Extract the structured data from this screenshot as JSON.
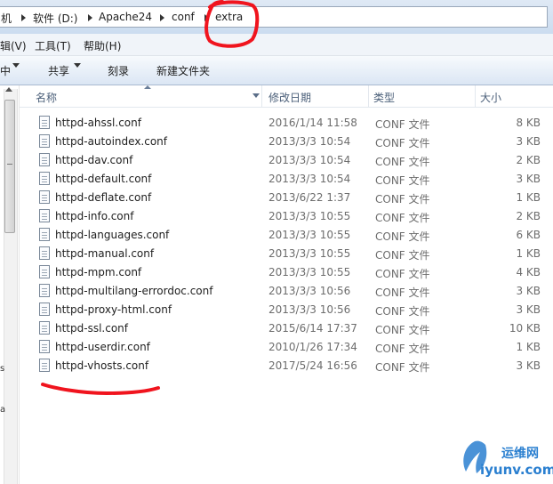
{
  "address": {
    "crumbs": [
      "机",
      "软件 (D:)",
      "Apache24",
      "conf",
      "extra"
    ]
  },
  "menu": {
    "items": [
      "辑(V)",
      "工具(T)",
      "帮助(H)"
    ]
  },
  "toolbar": {
    "left_partial": "中",
    "share_label": "共享",
    "burn_label": "刻录",
    "new_folder_label": "新建文件夹"
  },
  "columns": {
    "name": "名称",
    "date": "修改日期",
    "type": "类型",
    "size": "大小"
  },
  "left_stray": {
    "a": "s",
    "b": "a"
  },
  "files": [
    {
      "name": "httpd-ahssl.conf",
      "date": "2016/1/14 11:58",
      "type": "CONF 文件",
      "size": "8 KB"
    },
    {
      "name": "httpd-autoindex.conf",
      "date": "2013/3/3 10:54",
      "type": "CONF 文件",
      "size": "3 KB"
    },
    {
      "name": "httpd-dav.conf",
      "date": "2013/3/3 10:54",
      "type": "CONF 文件",
      "size": "2 KB"
    },
    {
      "name": "httpd-default.conf",
      "date": "2013/3/3 10:54",
      "type": "CONF 文件",
      "size": "3 KB"
    },
    {
      "name": "httpd-deflate.conf",
      "date": "2013/6/22 1:37",
      "type": "CONF 文件",
      "size": "1 KB"
    },
    {
      "name": "httpd-info.conf",
      "date": "2013/3/3 10:55",
      "type": "CONF 文件",
      "size": "2 KB"
    },
    {
      "name": "httpd-languages.conf",
      "date": "2013/3/3 10:55",
      "type": "CONF 文件",
      "size": "6 KB"
    },
    {
      "name": "httpd-manual.conf",
      "date": "2013/3/3 10:55",
      "type": "CONF 文件",
      "size": "1 KB"
    },
    {
      "name": "httpd-mpm.conf",
      "date": "2013/3/3 10:55",
      "type": "CONF 文件",
      "size": "4 KB"
    },
    {
      "name": "httpd-multilang-errordoc.conf",
      "date": "2013/3/3 10:56",
      "type": "CONF 文件",
      "size": "3 KB"
    },
    {
      "name": "httpd-proxy-html.conf",
      "date": "2013/3/3 10:56",
      "type": "CONF 文件",
      "size": "3 KB"
    },
    {
      "name": "httpd-ssl.conf",
      "date": "2015/6/14 17:37",
      "type": "CONF 文件",
      "size": "10 KB"
    },
    {
      "name": "httpd-userdir.conf",
      "date": "2010/1/26 17:34",
      "type": "CONF 文件",
      "size": "1 KB"
    },
    {
      "name": "httpd-vhosts.conf",
      "date": "2017/5/24 16:56",
      "type": "CONF 文件",
      "size": "3 KB"
    }
  ],
  "annotation_color": "#f0141e",
  "watermark": {
    "line1": "运维网",
    "line2": "iyunv.com",
    "color": "#2a7fd0"
  }
}
